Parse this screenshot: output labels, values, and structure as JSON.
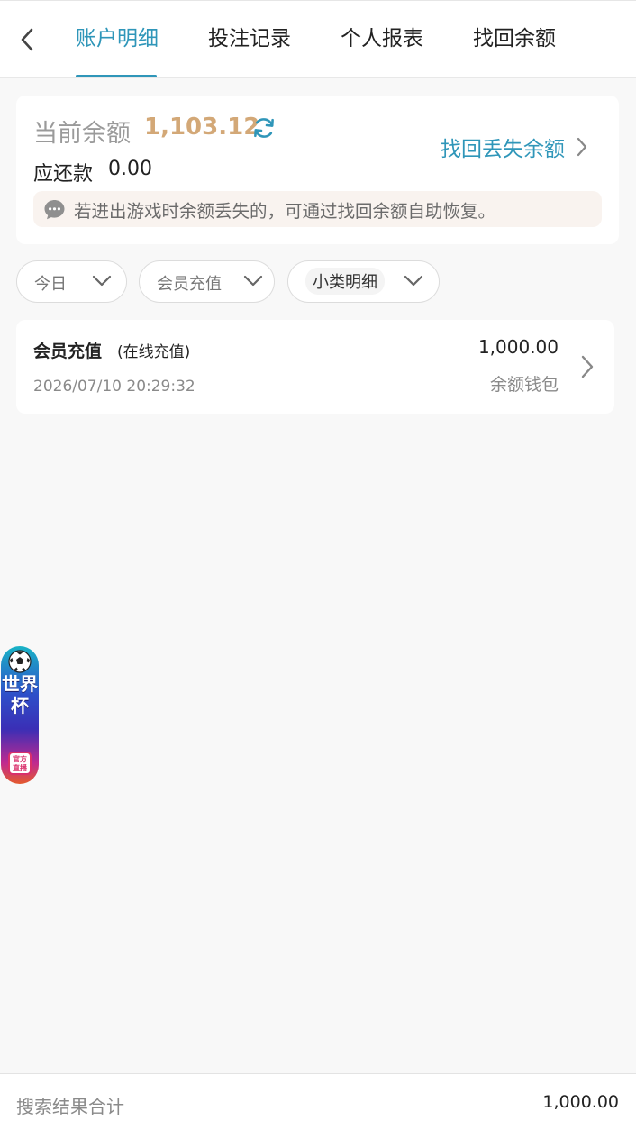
{
  "nav": {
    "tabs": [
      {
        "label": "账户明细",
        "active": true
      },
      {
        "label": "投注记录",
        "active": false
      },
      {
        "label": "个人报表",
        "active": false
      },
      {
        "label": "找回余额",
        "active": false
      }
    ]
  },
  "balance": {
    "label": "当前余额",
    "value": "1,103.12",
    "due_label": "应还款",
    "due_value": "0.00",
    "recover_link": "找回丢失余额",
    "notice": "若进出游戏时余额丢失的，可通过找回余额自助恢复。"
  },
  "filters": [
    {
      "label": "今日"
    },
    {
      "label": "会员充值"
    },
    {
      "label": "小类明细"
    }
  ],
  "records": [
    {
      "title": "会员充值",
      "subtitle": "(在线充值)",
      "time": "2026/07/10 20:29:32",
      "amount": "1,000.00",
      "wallet": "余额钱包"
    }
  ],
  "badge": {
    "text": "世界杯",
    "tag": "官方直播"
  },
  "footer": {
    "label": "搜索结果合计",
    "total": "1,000.00"
  },
  "colors": {
    "accent": "#2f96b9",
    "balance_value": "#d3a877",
    "notice_bg": "#f9f3ef",
    "page_bg": "#f8f8f8"
  }
}
